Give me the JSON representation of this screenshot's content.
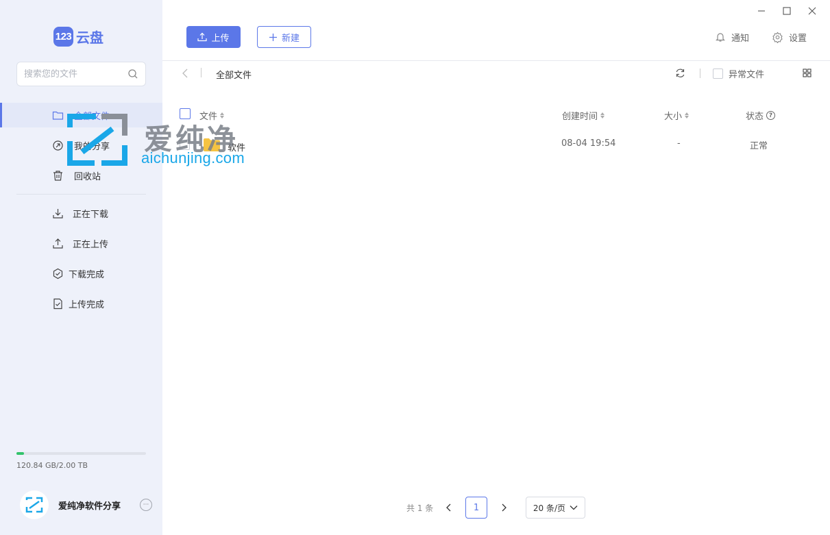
{
  "app": {
    "logo_badge": "123",
    "logo_text": "云盘"
  },
  "search": {
    "placeholder": "搜索您的文件"
  },
  "sidebar": {
    "items": [
      {
        "label": "全部文件",
        "icon": "folder-icon",
        "active": true
      },
      {
        "label": "我的分享",
        "icon": "share-icon"
      },
      {
        "label": "回收站",
        "icon": "trash-icon"
      },
      {
        "label": "正在下载",
        "icon": "download-icon"
      },
      {
        "label": "正在上传",
        "icon": "upload-icon"
      },
      {
        "label": "下载完成",
        "icon": "download-done-icon"
      },
      {
        "label": "上传完成",
        "icon": "upload-done-icon"
      }
    ],
    "storage": {
      "text": "120.84 GB/2.00 TB",
      "used_fraction": 0.059
    },
    "user": {
      "name": "爱纯净软件分享",
      "more": "···"
    }
  },
  "toolbar": {
    "upload_label": "上传",
    "new_label": "新建",
    "notify_label": "通知",
    "settings_label": "设置"
  },
  "breadcrumb": {
    "current": "全部文件"
  },
  "filter": {
    "abnormal_label": "异常文件"
  },
  "table": {
    "headers": {
      "name": "文件",
      "created": "创建时间",
      "size": "大小",
      "status": "状态"
    },
    "rows": [
      {
        "name": "软件",
        "created": "08-04 19:54",
        "size": "-",
        "status": "正常"
      }
    ]
  },
  "pagination": {
    "total": "共 1 条",
    "current_page": "1",
    "page_size": "20 条/页"
  },
  "watermark": {
    "cn": "爱纯净",
    "en": "aichunjing.com"
  },
  "colors": {
    "accent": "#5b77e8",
    "sidebar_bg": "#eef1fa",
    "storage_fill": "#33c36b",
    "folder": "#f5c342",
    "watermark_blue": "#1aa7e8"
  }
}
